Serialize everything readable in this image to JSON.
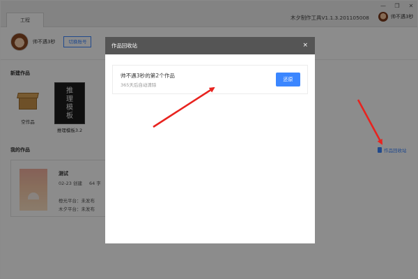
{
  "window": {
    "tab": "工程",
    "version": "木夕制作工具V1.1.3.201105008",
    "username": "帅不遇3秒",
    "controls": [
      "—",
      "❐",
      "✕"
    ]
  },
  "header": {
    "username": "帅不遇3秒",
    "switch_button": "切换账号"
  },
  "new_works": {
    "title": "新建作品",
    "items": [
      {
        "label": "空作品",
        "icon": "box-icon"
      },
      {
        "label": "推理模板3.2",
        "thumb_text": "推\n理\n模\n板"
      }
    ]
  },
  "my_works": {
    "title": "我的作品",
    "recycle_link": "作品回收站",
    "card": {
      "title": "测试",
      "date": "02-23 创建",
      "words": "64 字",
      "line1": "橙光平台：未发布",
      "line2": "木夕平台：未发布"
    }
  },
  "modal": {
    "title": "作品回收站",
    "close": "×",
    "item": {
      "name": "帅不遇3秒的第2个作品",
      "note": "365天后自动清除",
      "restore": "还原"
    }
  },
  "colors": {
    "accent": "#3b86ff",
    "modal_header": "#555555",
    "arrow": "#e8231f"
  }
}
